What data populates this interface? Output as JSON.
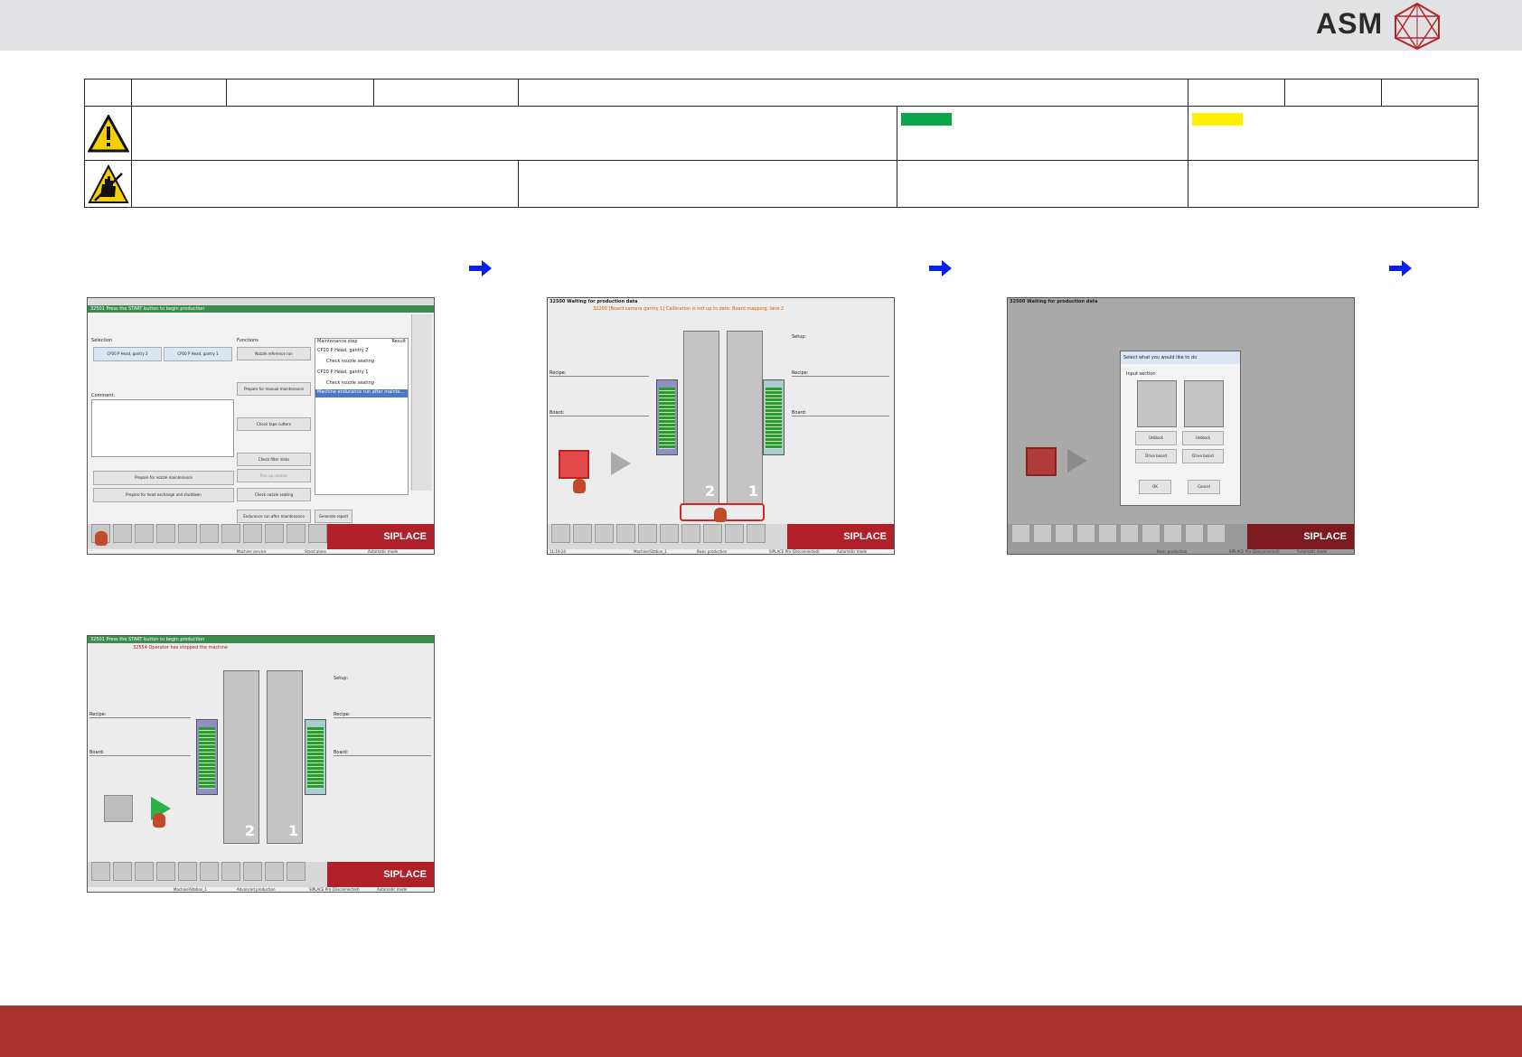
{
  "header": {
    "logo_text": "ASM",
    "brand_color": "#a8302e"
  },
  "table": {
    "warning_icon": "warning-triangle-icon",
    "esd_icon": "esd-hand-icon",
    "status_colors": [
      "#0aa64a",
      "#fff200"
    ]
  },
  "steps": {
    "arrow_color": "#0a1ef0",
    "arrow_icon": "right-arrow-icon"
  },
  "screens": {
    "s1": {
      "title": "32501 Press the START button to begin production",
      "selection_label": "Selection",
      "gantry2": "CP20 P Head, gantry 2",
      "gantry1": "CP20 P Head, gantry 1",
      "comment_label": "Comment:",
      "functions_label": "Functions",
      "fn_buttons": [
        "Nozzle reference run",
        "Prepare for manual maintenance",
        "Check tape cutters",
        "Check filter disks",
        "Pick up nozzles",
        "Check nozzle seating",
        "Endurance run after maintenance"
      ],
      "maint_label": "Maintenance step",
      "result_label": "Result",
      "steps": [
        "CP20 P Head, gantry 2",
        "Check nozzle seating",
        "CP20 P Head, gantry 1",
        "Check nozzle seating",
        "Machine endurance run after mainte..."
      ],
      "prep_nozzle": "Prepare for nozzle maintenance",
      "prep_head": "Prepare for head exchange and shutdown",
      "generate_report": "Generate report",
      "siplace": "SIPLACE",
      "status": [
        "Machine service",
        "Stand alone",
        "Automatic mode"
      ]
    },
    "s2": {
      "title": "32500 Waiting for production data",
      "message": "32200 [Board camera gantry 1] Calibration is not up to date: Board mapping; lane 2",
      "recipe_label": "Recipe:",
      "board_label": "Board:",
      "setup_label": "Setup:",
      "lane2": "2",
      "lane1": "1",
      "siplace": "SIPLACE",
      "status": [
        "11:19:24",
        "Machine\\Station_1",
        "Basic production",
        "SIPLACE Pro (Disconnected)",
        "Automatic mode"
      ]
    },
    "s3": {
      "title": "32500 Waiting for production data",
      "dialog_title": "Select what you would like to do",
      "input_section": "Input section",
      "unblock": "Unblock",
      "drive_board": "Drive board",
      "ok": "OK",
      "cancel": "Cancel",
      "siplace": "SIPLACE",
      "status": [
        "Basic production",
        "SIPLACE Pro (Disconnected)",
        "Automatic mode"
      ]
    },
    "s4": {
      "title": "32501 Press the START button to begin production",
      "message": "32554 Operator has stopped the machine",
      "recipe_label": "Recipe:",
      "board_label": "Board:",
      "setup_label": "Setup:",
      "lane2": "2",
      "lane1": "1",
      "siplace": "SIPLACE",
      "status": [
        "Machine\\Station_1",
        "Advanced production",
        "SIPLACE Pro (Disconnected)",
        "Automatic mode"
      ]
    }
  }
}
